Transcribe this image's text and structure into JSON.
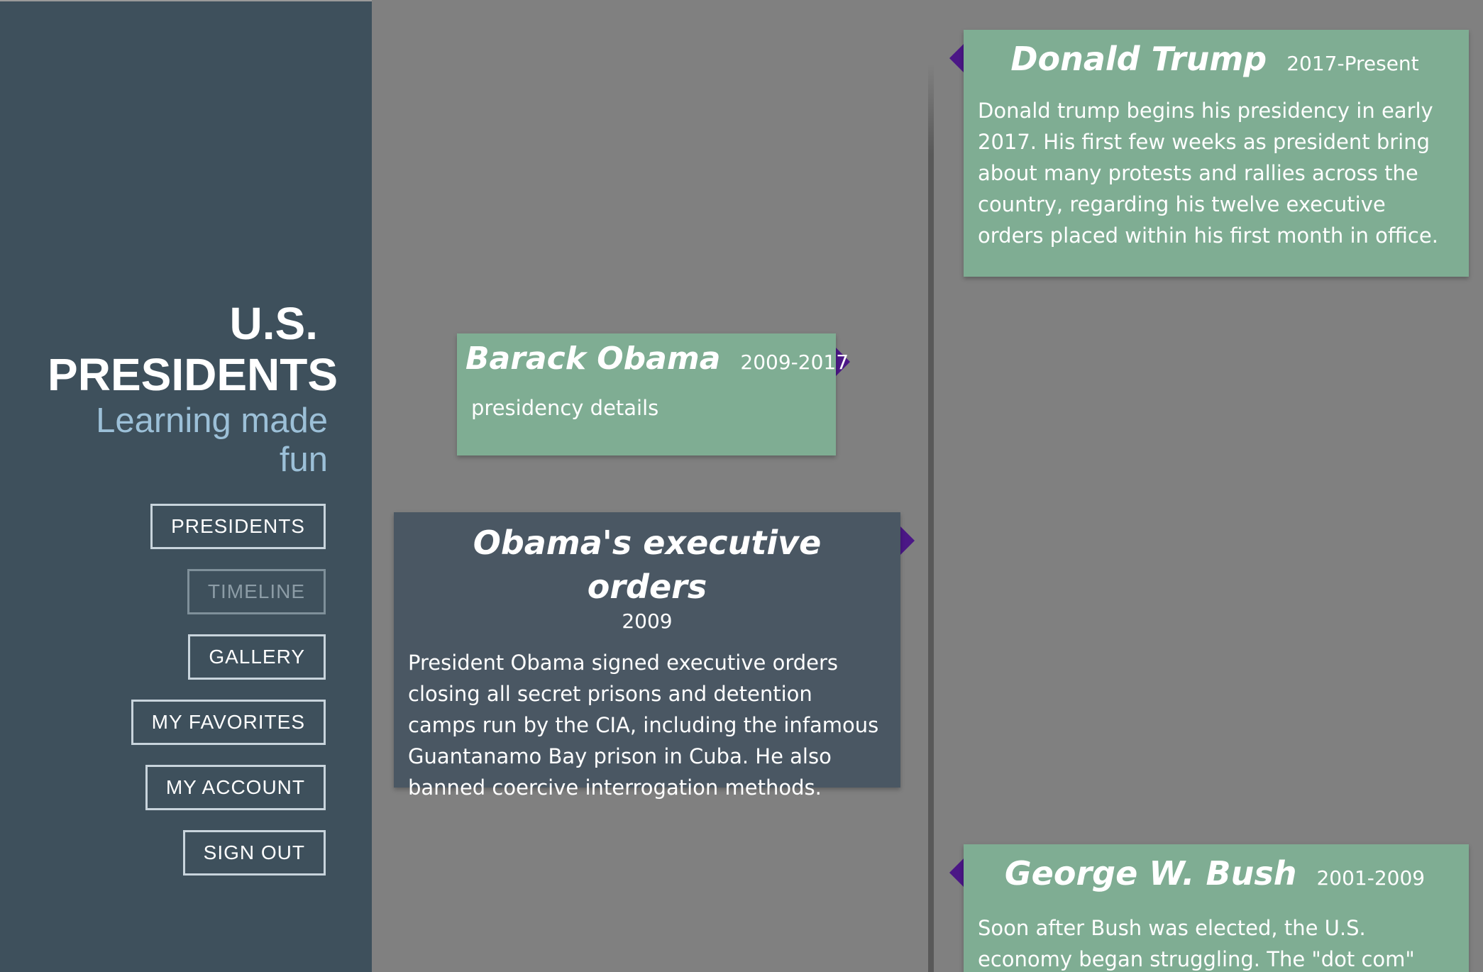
{
  "sidebar": {
    "brand": {
      "title_line1": "U.S.",
      "title_line2": "PRESIDENTS",
      "tagline": "Learning made fun"
    },
    "nav": [
      {
        "label": "PRESIDENTS",
        "active": false
      },
      {
        "label": "TIMELINE",
        "active": true
      },
      {
        "label": "GALLERY",
        "active": false
      },
      {
        "label": "MY FAVORITES",
        "active": false
      },
      {
        "label": "MY ACCOUNT",
        "active": false
      },
      {
        "label": "SIGN OUT",
        "active": false
      }
    ]
  },
  "timeline": {
    "entries": [
      {
        "name": "Donald Trump",
        "years": "2017-Present",
        "text": "Donald trump begins his presidency in early 2017. His first few weeks as president bring about many protests and rallies across the country, regarding his twelve executive orders placed within his first month in office."
      },
      {
        "name": "Barack Obama",
        "years": "2009-2017",
        "text": "presidency details"
      },
      {
        "name": "Obama's executive orders",
        "years": "2009",
        "text": "President Obama signed executive orders closing all secret prisons and detention camps run by the CIA, including the infamous Guantanamo Bay prison in Cuba. He also banned coercive interrogation methods."
      },
      {
        "name": "George W. Bush",
        "years": "2001-2009",
        "text": "Soon after Bush was elected, the U.S. economy began struggling. The \"dot com\""
      }
    ]
  },
  "colors": {
    "sidebar_bg": "#3e505c",
    "main_bg": "#808080",
    "president_card": "#7fad93",
    "event_card": "#4a5763",
    "pointer": "#4b1786",
    "tagline": "#9cc0d8"
  }
}
